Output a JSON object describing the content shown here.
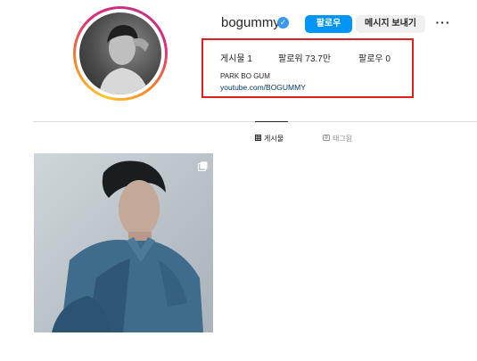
{
  "profile": {
    "username": "bogummy",
    "verified_icon": "verified-badge-icon",
    "follow_label": "팔로우",
    "message_label": "메시지 보내기",
    "more_icon": "more-icon",
    "more_label": "···",
    "stats": {
      "posts_label": "게시물",
      "posts_value": "1",
      "followers_label": "팔로워",
      "followers_value": "73.7만",
      "following_label": "팔로우",
      "following_value": "0"
    },
    "full_name": "PARK BO GUM",
    "link": "youtube.com/BOGUMMY"
  },
  "tabs": [
    {
      "label": "게시물",
      "icon": "grid-icon",
      "active": true
    },
    {
      "label": "태그됨",
      "icon": "tagged-icon",
      "active": false
    }
  ],
  "posts": [
    {
      "icon": "multi-photo-icon"
    }
  ],
  "colors": {
    "accent": "#0095f6",
    "highlight_box": "#e01e1e",
    "link": "#00376b"
  }
}
